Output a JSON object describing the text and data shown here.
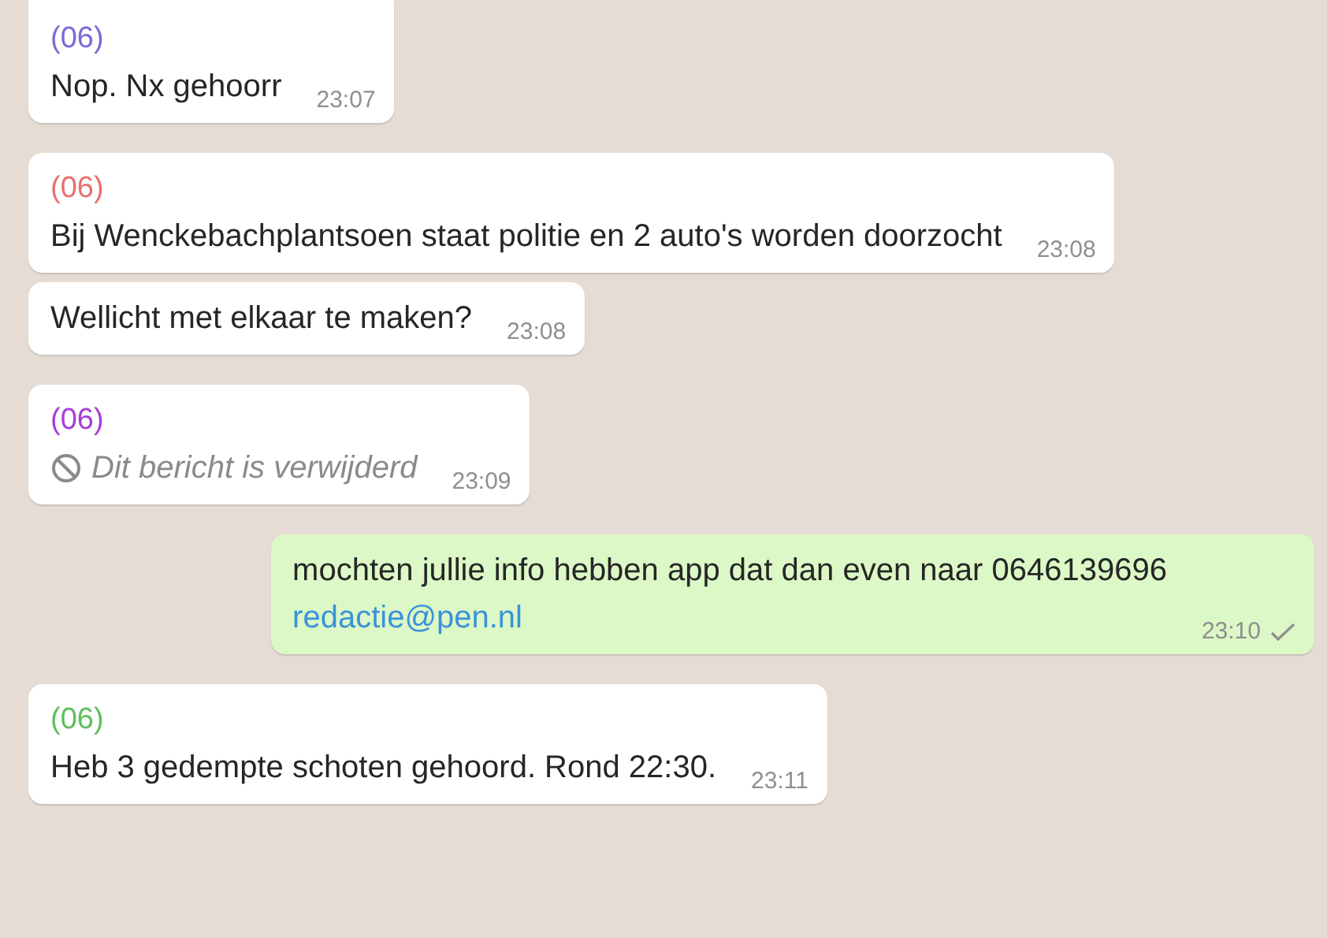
{
  "messages": [
    {
      "kind": "incoming",
      "sender": "(06)",
      "color": "#7a6ad8",
      "text": "Nop. Nx gehoorr",
      "time": "23:07"
    },
    {
      "kind": "incoming",
      "sender": "(06)",
      "color": "#e8706f",
      "text": "Bij Wenckebachplantsoen staat politie en 2 auto's worden doorzocht",
      "time": "23:08"
    },
    {
      "kind": "incoming",
      "text": "Wellicht met elkaar te maken?",
      "time": "23:08"
    },
    {
      "kind": "deleted",
      "sender": "(06)",
      "color": "#a83ed4",
      "text": "Dit bericht is verwijderd",
      "time": "23:09"
    },
    {
      "kind": "outgoing",
      "text": "mochten jullie info hebben app dat dan even naar 0646139696",
      "link": "redactie@pen.nl",
      "time": "23:10",
      "sent": true
    },
    {
      "kind": "incoming",
      "sender": "(06)",
      "color": "#5fbf5a",
      "text": "Heb 3 gedempte schoten gehoord. Rond 22:30.",
      "time": "23:11"
    }
  ]
}
